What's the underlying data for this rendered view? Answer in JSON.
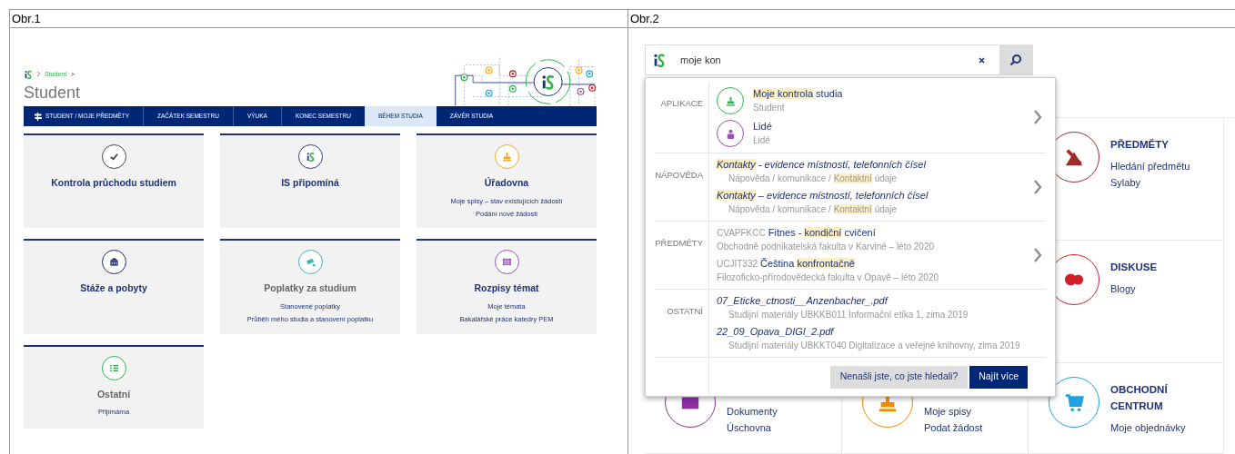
{
  "figure_1": {
    "caption": "Obr.1",
    "breadcrumb": [
      "Student"
    ],
    "title": "Student",
    "nav": [
      {
        "label": "STUDENT / MOJE PŘEDMĚTY",
        "kind": "signpost",
        "selected": false
      },
      {
        "label": "ZAČÁTEK SEMESTRU",
        "kind": "text",
        "selected": false
      },
      {
        "label": "VÝUKA",
        "kind": "text",
        "selected": false
      },
      {
        "label": "KONEC SEMESTRU",
        "kind": "text",
        "selected": false
      },
      {
        "label": "BĚHEM STUDIA",
        "kind": "text",
        "selected": true
      },
      {
        "label": "ZÁVĚR STUDIA",
        "kind": "text",
        "selected": false
      }
    ],
    "cards": [
      {
        "title": "Kontrola průchodu studiem",
        "muted": false,
        "color": "#444444"
      },
      {
        "title": "IS připomíná",
        "muted": false,
        "color": "#2d3a8c"
      },
      {
        "title": "Úřadovna",
        "muted": false,
        "color": "#f5a623",
        "links": [
          "Moje spisy – stav existujících žádostí",
          "Podání nové žádosti"
        ]
      },
      {
        "title": "Stáže a pobyty",
        "muted": false,
        "color": "#1b2a6b"
      },
      {
        "title": "Poplatky za studium",
        "muted": true,
        "color": "#3bb3b8",
        "links": [
          "Stanovené poplatky",
          "Průběh mého studia a stanovení poplatku"
        ]
      },
      {
        "title": "Rozpisy témat",
        "muted": false,
        "color": "#9b4fb5",
        "links": [
          "Moje témata",
          "Bakalářské práce katedry PEM"
        ]
      },
      {
        "title": "Ostatní",
        "muted": true,
        "color": "#2eb24c",
        "links": [
          "Přijímárna"
        ]
      }
    ]
  },
  "figure_2": {
    "caption": "Obr.2",
    "search": {
      "value": "moje kon"
    },
    "sections": [
      {
        "label": "APLIKACE",
        "more": true,
        "items": [
          {
            "kind": "app",
            "color": "#2eb24c",
            "title": [
              {
                "text": "Moje kontrola",
                "highlight": true
              },
              {
                "text": " studia",
                "highlight": false
              }
            ],
            "detail": [
              {
                "text": "Student",
                "highlight": false
              }
            ]
          },
          {
            "kind": "app",
            "color": "#9b4fb5",
            "title": [
              {
                "text": "Lidé",
                "highlight": false
              }
            ],
            "detail": [
              {
                "text": "Lidé",
                "highlight": false
              }
            ]
          }
        ]
      },
      {
        "label": "NÁPOVĚDA",
        "more": true,
        "items": [
          {
            "kind": "help",
            "title": [
              {
                "text": "Kontakty",
                "highlight": true
              },
              {
                "text": " - evidence místností, telefonních čísel",
                "highlight": false
              }
            ],
            "detail": [
              {
                "text": "Nápověda / komunikace / ",
                "highlight": false
              },
              {
                "text": "Kontaktní",
                "highlight": true
              },
              {
                "text": " údaje",
                "highlight": false
              }
            ]
          },
          {
            "kind": "help",
            "title": [
              {
                "text": "Kontakty",
                "highlight": true
              },
              {
                "text": " – evidence místností, telefonních čísel",
                "highlight": false
              }
            ],
            "detail": [
              {
                "text": "Nápověda / komunikace / ",
                "highlight": false
              },
              {
                "text": "Kontaktní",
                "highlight": true
              },
              {
                "text": " údaje",
                "highlight": false
              }
            ]
          }
        ]
      },
      {
        "label": "PŘEDMĚTY",
        "more": true,
        "items": [
          {
            "kind": "course",
            "code": "CVAPFKCC",
            "title": [
              {
                "text": "Fitnes - ",
                "highlight": false
              },
              {
                "text": "kondiční",
                "highlight": true
              },
              {
                "text": " cvičení",
                "highlight": false
              }
            ],
            "detail": [
              {
                "text": "Obchodně podnikatelská fakulta v Karviné – léto 2020",
                "highlight": false
              }
            ]
          },
          {
            "kind": "course",
            "code": "UCJIT332",
            "title": [
              {
                "text": "Čeština ",
                "highlight": false
              },
              {
                "text": "konfrontačně",
                "highlight": true
              }
            ],
            "detail": [
              {
                "text": "Filozoficko-přírodovědecká fakulta v Opavě – léto 2020",
                "highlight": false
              }
            ]
          }
        ]
      },
      {
        "label": "OSTATNÍ",
        "more": false,
        "items": [
          {
            "kind": "file",
            "title": [
              {
                "text": "07_Eticke_ctnosti__Anzenbacher_.pdf",
                "highlight": false
              }
            ],
            "detail": [
              {
                "text": "Studijní materiály UBKKB011 Informační etika 1, zima 2019",
                "highlight": false
              }
            ]
          },
          {
            "kind": "file",
            "title": [
              {
                "text": "22_09_Opava_DIGI_2.pdf",
                "highlight": false
              }
            ],
            "detail": [
              {
                "text": "Studijní materiály UBKKT040 Digitalizace a veřejné knihovny, zima 2019",
                "highlight": false
              }
            ]
          }
        ]
      }
    ],
    "not_found_button": "Nenašli jste, co jste hledali?",
    "more_button": "Najít více",
    "background_cards": [
      {
        "title": "PŘEDMĚTY",
        "color": "#a02b2b",
        "links": [
          "Hledání předmětu",
          "Sylaby"
        ]
      },
      {
        "title": "DISKUSE",
        "color": "#d0202a",
        "links": [
          "Blogy"
        ]
      },
      {
        "color": "#8e2ea3",
        "links": [
          "Dokumenty",
          "Úschovna"
        ]
      },
      {
        "color": "#f08c00",
        "links": [
          "Moje spisy",
          "Podat žádost"
        ]
      },
      {
        "title": "OBCHODNÍ CENTRUM",
        "color": "#1fa3e0",
        "links": [
          "Moje objednávky"
        ]
      }
    ]
  }
}
